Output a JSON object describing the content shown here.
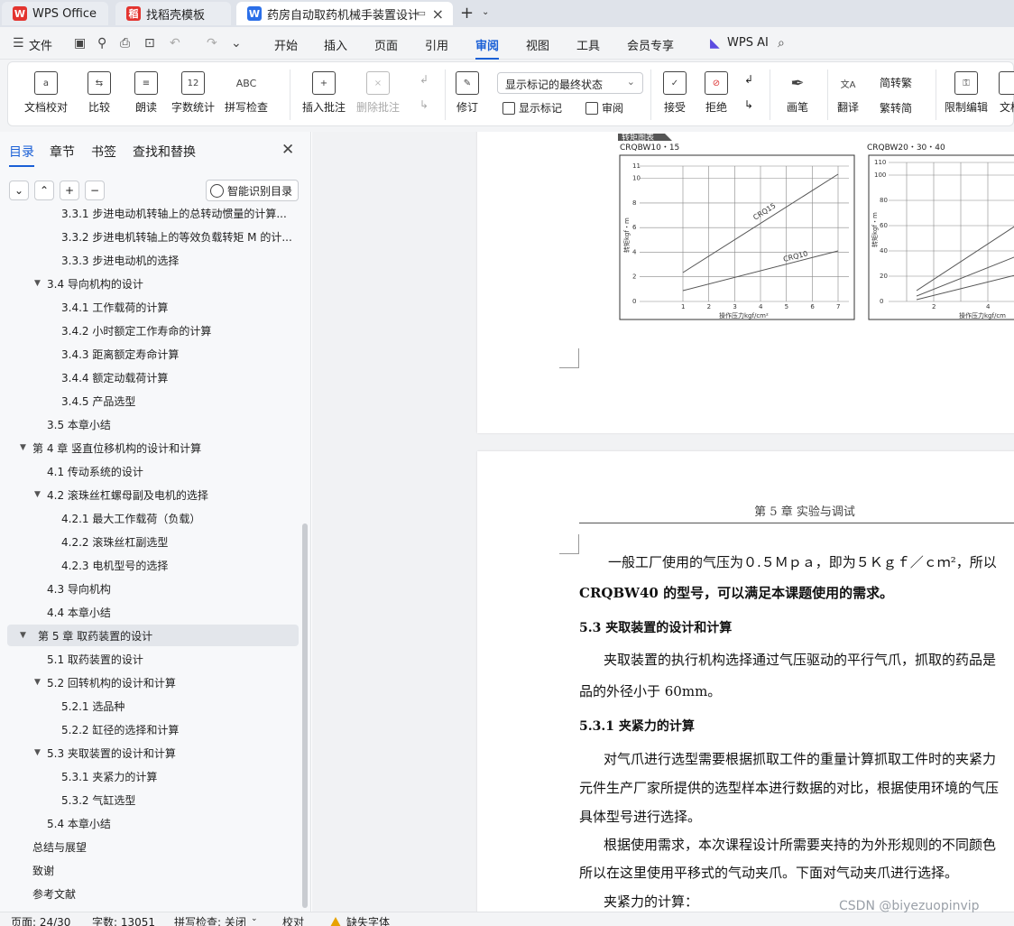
{
  "tabs": {
    "t1": "WPS Office",
    "t2": "找稻壳模板",
    "t3": "药房自动取药机械手装置设计"
  },
  "menu": {
    "file": "文件",
    "items": [
      "开始",
      "插入",
      "页面",
      "引用",
      "审阅",
      "视图",
      "工具",
      "会员专享"
    ],
    "active": "审阅",
    "ai": "WPS AI"
  },
  "ribbon": {
    "proof": "文档校对",
    "compare": "比较",
    "read": "朗读",
    "wordcount": "字数统计",
    "spell": "拼写检查",
    "insert_comment": "插入批注",
    "delete_comment": "删除批注",
    "revise": "修订",
    "markup_state": "显示标记的最终状态",
    "show_markup": "显示标记",
    "review": "审阅",
    "accept": "接受",
    "reject": "拒绝",
    "pen": "画笔",
    "translate": "翻译",
    "to_trad": "简转繁",
    "to_simp": "繁转简",
    "restrict": "限制编辑",
    "more": "文档"
  },
  "nav": {
    "tabs": [
      "目录",
      "章节",
      "书签",
      "查找和替换"
    ],
    "smart": "智能识别目录",
    "toc": [
      {
        "t": "3.3.1 步进电动机转轴上的总转动惯量的计算...",
        "lvl": 3
      },
      {
        "t": "3.3.2 步进电机转轴上的等效负载转矩 M 的计...",
        "lvl": 3
      },
      {
        "t": "3.3.3 步进电动机的选择",
        "lvl": 3
      },
      {
        "t": "3.4 导向机构的设计",
        "lvl": 2,
        "exp": true
      },
      {
        "t": "3.4.1  工作载荷的计算",
        "lvl": 3
      },
      {
        "t": "3.4.2 小时额定工作寿命的计算",
        "lvl": 3
      },
      {
        "t": "3.4.3 距离额定寿命计算",
        "lvl": 3
      },
      {
        "t": "3.4.4 额定动载荷计算",
        "lvl": 3
      },
      {
        "t": "3.4.5  产品选型",
        "lvl": 3
      },
      {
        "t": "3.5 本章小结",
        "lvl": 2
      },
      {
        "t": "第 4 章  竖直位移机构的设计和计算",
        "lvl": 1,
        "exp": true
      },
      {
        "t": "4.1 传动系统的设计",
        "lvl": 2
      },
      {
        "t": "4.2 滚珠丝杠螺母副及电机的选择",
        "lvl": 2,
        "exp": true
      },
      {
        "t": "4.2.1 最大工作载荷（负载）",
        "lvl": 3
      },
      {
        "t": "4.2.2 滚珠丝杠副选型",
        "lvl": 3
      },
      {
        "t": "4.2.3 电机型号的选择",
        "lvl": 3
      },
      {
        "t": "4.3  导向机构",
        "lvl": 2
      },
      {
        "t": "4.4  本章小结",
        "lvl": 2
      },
      {
        "t": "第 5 章  取药装置的设计",
        "lvl": 1,
        "exp": true,
        "sel": true
      },
      {
        "t": "5.1 取药装置的设计",
        "lvl": 2
      },
      {
        "t": "5.2  回转机构的设计和计算",
        "lvl": 2,
        "exp": true
      },
      {
        "t": "5.2.1 选品种",
        "lvl": 3
      },
      {
        "t": "5.2.2 缸径的选择和计算",
        "lvl": 3
      },
      {
        "t": "5.3  夹取装置的设计和计算",
        "lvl": 2,
        "exp": true
      },
      {
        "t": "5.3.1  夹紧力的计算",
        "lvl": 3
      },
      {
        "t": "5.3.2  气缸选型",
        "lvl": 3
      },
      {
        "t": "5.4  本章小结",
        "lvl": 2
      },
      {
        "t": "总结与展望",
        "lvl": 1
      },
      {
        "t": "致谢",
        "lvl": 1
      },
      {
        "t": "参考文献",
        "lvl": 1
      }
    ]
  },
  "doc": {
    "fig_tag": "转矩图表",
    "chart1_title": "CRQBW10・15",
    "chart2_title": "CRQBW20・30・40",
    "ylabel": "转矩kgf・m",
    "xlabel": "操作压力kgf/cm²",
    "xlabel2": "操作压力kgf/cm",
    "crq15": "CRQ15",
    "crq10": "CRQ10",
    "header": "第 5 章  实验与调试",
    "p1": "一般工厂使用的气压为０.５Ｍｐａ，即为５Ｋｇｆ／ｃｍ²，所以",
    "p1b": "CRQBW40 的型号，可以满足本课题使用的需求。",
    "h53": "5.3  夹取装置的设计和计算",
    "p2": "夹取装置的执行机构选择通过气压驱动的平行气爪，抓取的药品是",
    "p2b": "品的外径小于 60mm。",
    "h531": "5.3.1  夹紧力的计算",
    "p3": "对气爪进行选型需要根据抓取工件的重量计算抓取工件时的夹紧力",
    "p3b": "元件生产厂家所提供的选型样本进行数据的对比，根据使用环境的气压",
    "p3c": "具体型号进行选择。",
    "p4": "根据使用需求，本次课程设计所需要夹持的为外形规则的不同颜色",
    "p4b": "所以在这里使用平移式的气动夹爪。下面对气动夹爪进行选择。",
    "p5": "夹紧力的计算："
  },
  "status": {
    "page": "页面: 24/30",
    "words": "字数: 13051",
    "spell": "拼写检查: 关闭",
    "proof": "校对",
    "missing_font": "缺失字体"
  },
  "watermark": "CSDN @biyezuopinvip",
  "colors": {
    "accent": "#1a5fd6",
    "wps_red": "#e3342f"
  }
}
